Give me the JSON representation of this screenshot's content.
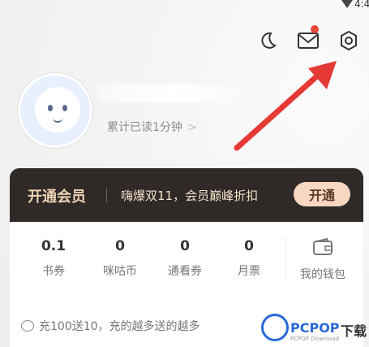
{
  "status": {
    "time": "4:4"
  },
  "header": {
    "icons": [
      "moon-icon",
      "mail-icon",
      "settings-icon"
    ],
    "mail_has_badge": true
  },
  "profile": {
    "read_text": "累计已读1分钟",
    "chevron": ">"
  },
  "vip": {
    "title": "开通会员",
    "promo": "嗨爆双11，会员巅峰折扣",
    "button": "开通"
  },
  "wallet": {
    "stats": [
      {
        "value": "0.1",
        "label": "书券"
      },
      {
        "value": "0",
        "label": "咪咕币"
      },
      {
        "value": "0",
        "label": "通看券"
      },
      {
        "value": "0",
        "label": "月票"
      }
    ],
    "wallet_label": "我的钱包",
    "promo": "充100送10，充的越多送的越多"
  },
  "watermark": {
    "text1": "PCPOP",
    "text2": "下载",
    "small": "PCPOP Download"
  },
  "colors": {
    "vip_bg": "#2f2a28",
    "accent": "#e8463a"
  }
}
